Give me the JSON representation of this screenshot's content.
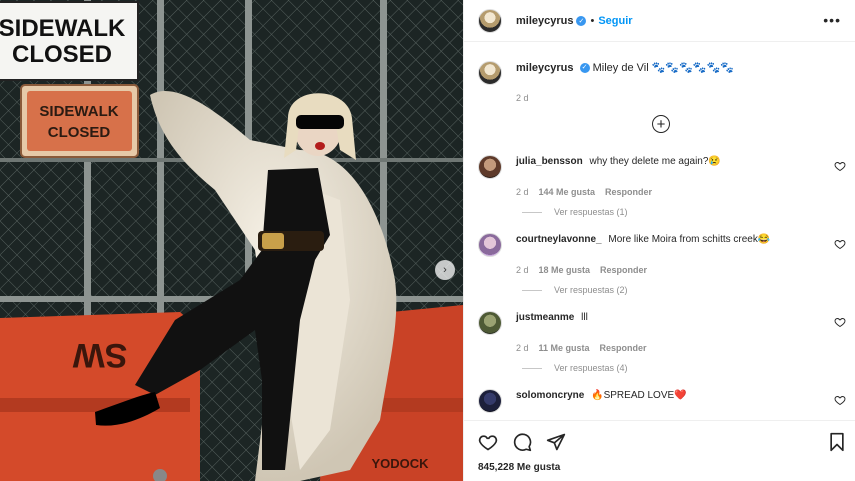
{
  "photo": {
    "sign_top_line1": "SIDEWALK",
    "sign_top_line2": "CLOSED",
    "sign_orange_line1": "SIDEWALK",
    "sign_orange_line2": "CLOSED",
    "barrier_text": "SW",
    "barrier_brand": "YODOCK"
  },
  "header": {
    "username": "mileycyrus",
    "dot": "•",
    "follow_label": "Seguir",
    "more_label": "•••"
  },
  "caption": {
    "username": "mileycyrus",
    "text": "Miley de Vil 🐾🐾🐾🐾🐾🐾",
    "time": "2 d"
  },
  "comments": [
    {
      "username": "julia_bensson",
      "text": "why they delete me again?😢",
      "time": "2 d",
      "likes": "144 Me gusta",
      "reply_label": "Responder",
      "replies_label": "Ver respuestas (1)"
    },
    {
      "username": "courtneylavonne_",
      "text": "More like Moira from schitts creek😂",
      "time": "2 d",
      "likes": "18 Me gusta",
      "reply_label": "Responder",
      "replies_label": "Ver respuestas (2)"
    },
    {
      "username": "justmeanme",
      "text": "lll⁣⁣⁣⁣⁣⁣⁣⁣⁣⁣⁣⁣⁣⁣⁣⁣",
      "time": "2 d",
      "likes": "11 Me gusta",
      "reply_label": "Responder",
      "replies_label": "Ver respuestas (4)"
    },
    {
      "username": "solomoncryne",
      "text": "🔥SPREAD LOVE❤️"
    }
  ],
  "footer": {
    "likes": "845,228 Me gusta"
  },
  "colors": {
    "accent": "#0095f6",
    "verified": "#3897f0",
    "muted": "#8e8e8e",
    "text": "#262626"
  }
}
